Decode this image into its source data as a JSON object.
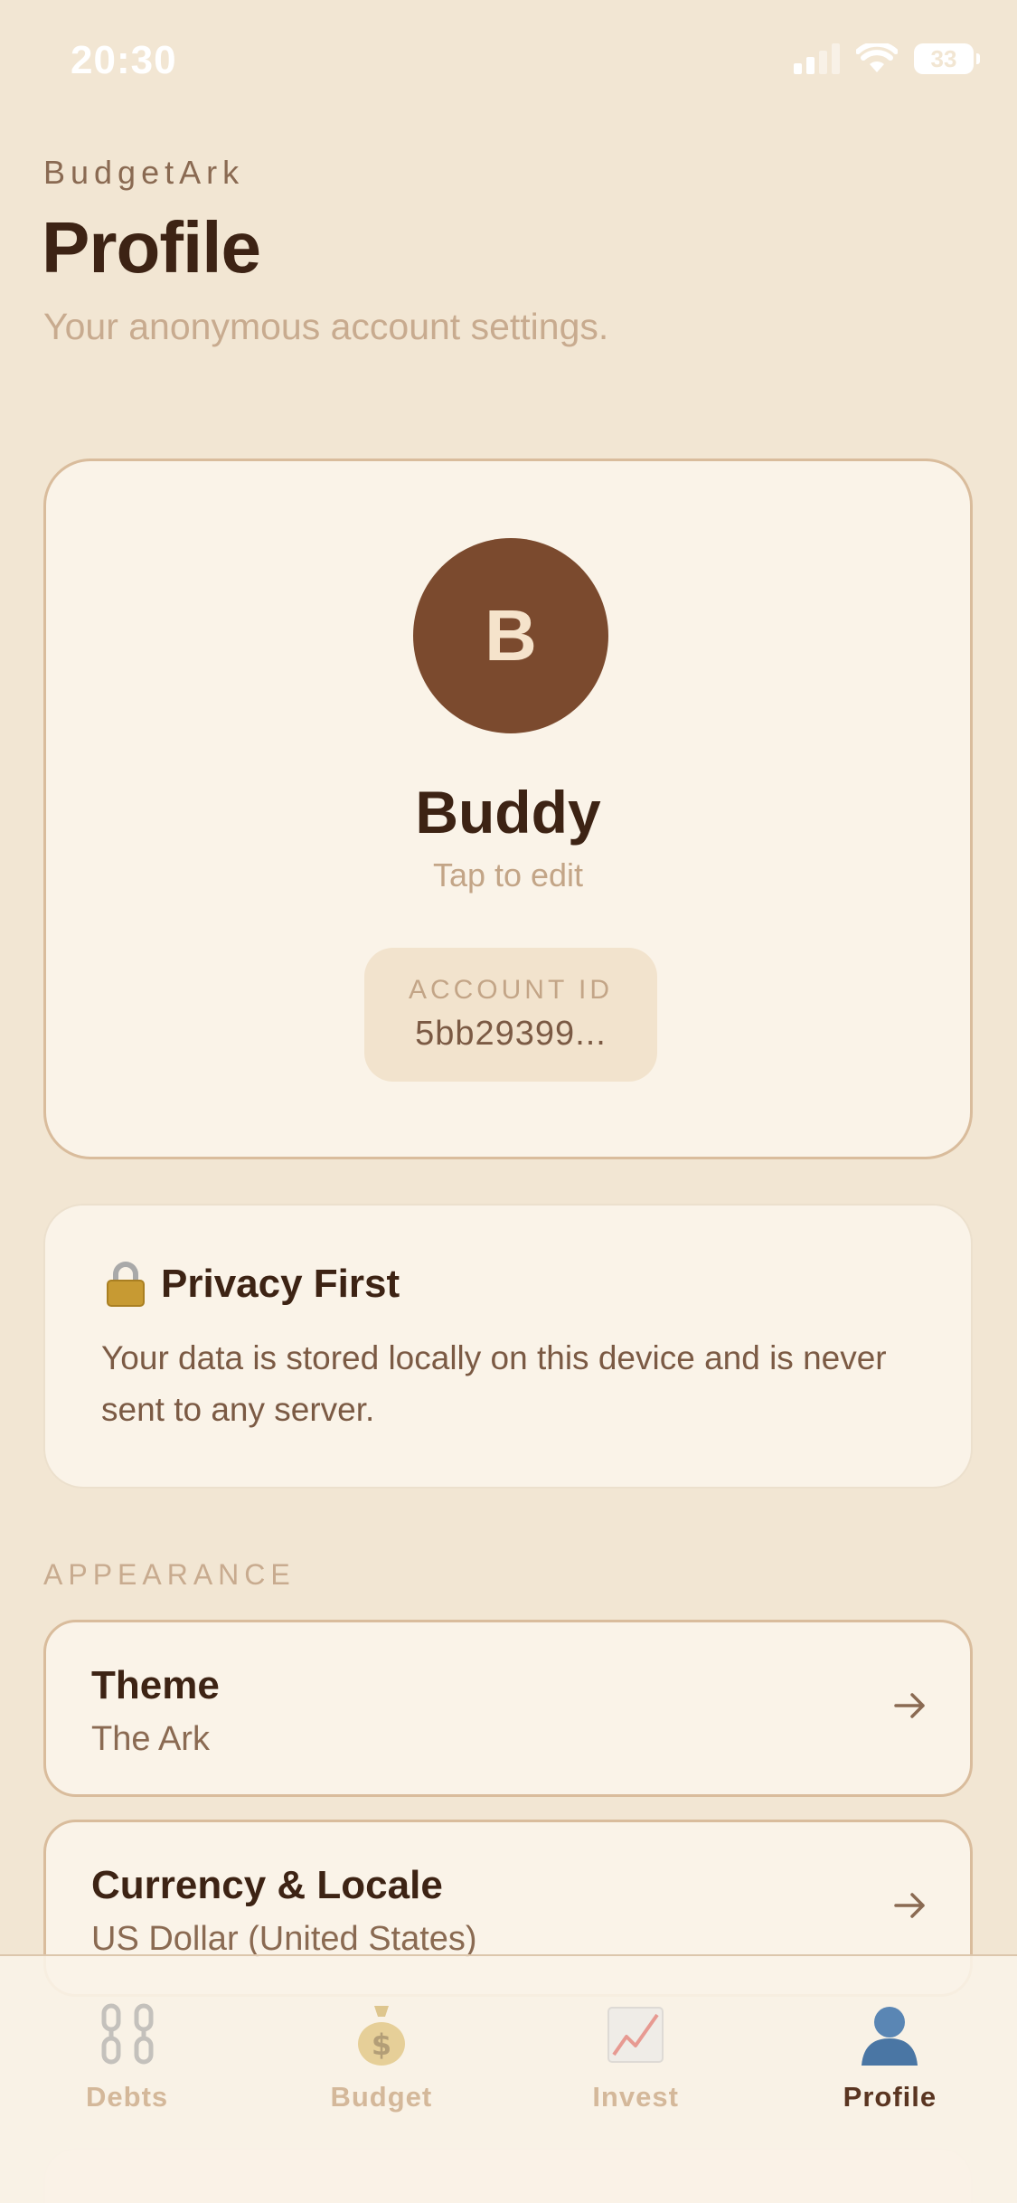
{
  "status_bar": {
    "time": "20:30",
    "battery": "33"
  },
  "header": {
    "app_name": "BudgetArk",
    "title": "Profile",
    "subtitle": "Your anonymous account settings."
  },
  "profile": {
    "avatar_initial": "B",
    "name": "Buddy",
    "edit_hint": "Tap to edit",
    "account_id_label": "ACCOUNT ID",
    "account_id_value": "5bb29399..."
  },
  "privacy": {
    "icon": "lock-icon",
    "title": "Privacy First",
    "text": "Your data is stored locally on this device and is never sent to any server."
  },
  "appearance": {
    "section_label": "APPEARANCE",
    "rows": [
      {
        "title": "Theme",
        "value": "The Ark",
        "icon": "arrow-right-icon"
      },
      {
        "title": "Currency & Locale",
        "value": "US Dollar (United States)",
        "icon": "arrow-right-icon"
      }
    ]
  },
  "tabs": [
    {
      "label": "Debts",
      "icon": "chains-icon",
      "active": false
    },
    {
      "label": "Budget",
      "icon": "money-bag-icon",
      "active": false
    },
    {
      "label": "Invest",
      "icon": "chart-increasing-icon",
      "active": false
    },
    {
      "label": "Profile",
      "icon": "person-silhouette-icon",
      "active": true
    }
  ],
  "colors": {
    "background": "#f2e6d3",
    "card": "#faf3e8",
    "accent": "#7b4a2e",
    "text_primary": "#3d2314",
    "text_muted": "#c8ab8f"
  }
}
